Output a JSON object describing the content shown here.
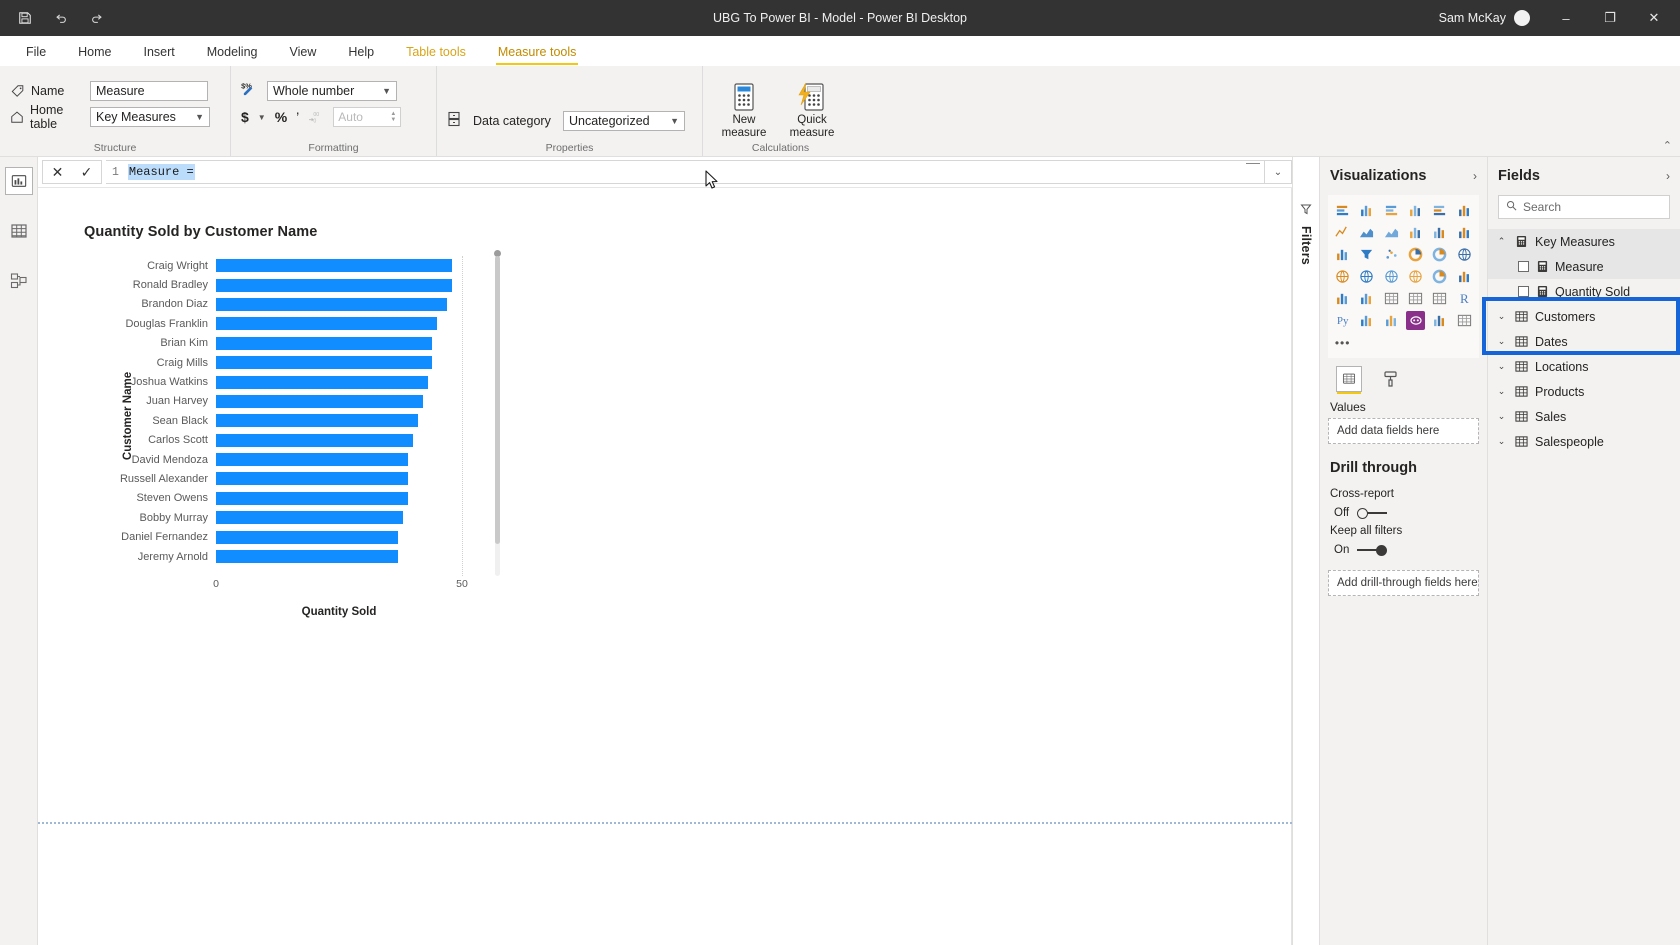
{
  "titlebar": {
    "document_title": "UBG To Power BI - Model - Power BI Desktop",
    "user": "Sam McKay",
    "save_icon": "save-icon",
    "undo_icon": "undo-icon",
    "redo_icon": "redo-icon",
    "minimize": "–",
    "restore": "❐",
    "close": "✕"
  },
  "ribbon_tabs": [
    {
      "label": "File",
      "state": "normal"
    },
    {
      "label": "Home",
      "state": "normal"
    },
    {
      "label": "Insert",
      "state": "normal"
    },
    {
      "label": "Modeling",
      "state": "normal"
    },
    {
      "label": "View",
      "state": "normal"
    },
    {
      "label": "Help",
      "state": "normal"
    },
    {
      "label": "Table tools",
      "state": "contextual"
    },
    {
      "label": "Measure tools",
      "state": "active"
    }
  ],
  "ribbon": {
    "groups": [
      {
        "name": "Structure"
      },
      {
        "name": "Formatting"
      },
      {
        "name": "Properties"
      },
      {
        "name": "Calculations"
      }
    ],
    "structure": {
      "name_label": "Name",
      "name_value": "Measure",
      "home_table_label": "Home table",
      "home_table_value": "Key Measures"
    },
    "formatting": {
      "format_value": "Whole number",
      "currency_symbol": "$",
      "percent_symbol": "%",
      "thousands_symbol": "’",
      "decimal_symbol": "→.0",
      "decimal_places_placeholder": "Auto"
    },
    "properties": {
      "data_category_label": "Data category",
      "data_category_value": "Uncategorized"
    },
    "calculations": {
      "new_measure_line1": "New",
      "new_measure_line2": "measure",
      "quick_measure_line1": "Quick",
      "quick_measure_line2": "measure"
    },
    "collapse_caret": "⌃"
  },
  "formula_bar": {
    "cancel_icon": "✕",
    "commit_icon": "✓",
    "line_number": "1",
    "expression": "Measure =",
    "expand_icon": "⌄"
  },
  "left_rail": [
    {
      "name": "report-view",
      "icon": "report-bar-chart-icon",
      "selected": true
    },
    {
      "name": "data-view",
      "icon": "data-table-icon",
      "selected": false
    },
    {
      "name": "model-view",
      "icon": "model-relationship-icon",
      "selected": false
    }
  ],
  "filters_pane": {
    "label": "Filters",
    "icon": "filter-funnel-icon"
  },
  "visualizations": {
    "title": "Visualizations",
    "expand_icon": "›",
    "icon_names": [
      "stacked-bar-chart-icon",
      "stacked-column-chart-icon",
      "clustered-bar-chart-icon",
      "clustered-column-chart-icon",
      "100-stacked-bar-chart-icon",
      "100-stacked-column-chart-icon",
      "line-chart-icon",
      "area-chart-icon",
      "stacked-area-chart-icon",
      "line-stacked-column-icon",
      "line-clustered-column-icon",
      "ribbon-chart-icon",
      "waterfall-chart-icon",
      "funnel-chart-icon",
      "scatter-chart-icon",
      "pie-chart-icon",
      "donut-chart-icon",
      "treemap-icon",
      "map-icon",
      "filled-map-icon",
      "shape-map-icon",
      "azure-map-icon",
      "gauge-chart-icon",
      "card-icon",
      "multi-row-card-icon",
      "kpi-icon",
      "slicer-icon",
      "table-icon",
      "matrix-icon",
      "r-script-visual-icon",
      "python-visual-icon",
      "key-influencers-icon",
      "decomposition-tree-icon",
      "qna-icon",
      "smart-narrative-icon",
      "paginated-report-icon",
      "more-options-icon"
    ],
    "field_tabs": [
      {
        "name": "fields-tab",
        "icon": "fields-build-icon",
        "selected": true
      },
      {
        "name": "format-tab",
        "icon": "format-paint-roller-icon",
        "selected": false
      }
    ],
    "values_label": "Values",
    "values_placeholder": "Add data fields here",
    "drill_through": {
      "title": "Drill through",
      "cross_report_label": "Cross-report",
      "cross_report_state": "Off",
      "cross_report_on": false,
      "keep_all_filters_label": "Keep all filters",
      "keep_all_filters_state": "On",
      "keep_all_filters_on": true,
      "drill_placeholder": "Add drill-through fields here"
    }
  },
  "fields": {
    "title": "Fields",
    "expand_icon": "›",
    "search_placeholder": "Search",
    "search_icon": "search-icon",
    "items": [
      {
        "label": "Key Measures",
        "type": "table",
        "icon": "measure-table-icon",
        "expanded": true,
        "depth": 0,
        "highlighted": true
      },
      {
        "label": "Measure",
        "type": "measure",
        "icon": "measure-icon",
        "depth": 1,
        "checked": false,
        "highlighted": true
      },
      {
        "label": "Quantity Sold",
        "type": "measure",
        "icon": "measure-icon",
        "depth": 1,
        "checked": false,
        "highlighted": false
      },
      {
        "label": "Customers",
        "type": "table",
        "icon": "table-icon",
        "expanded": false,
        "depth": 0,
        "highlighted": false
      },
      {
        "label": "Dates",
        "type": "table",
        "icon": "table-icon",
        "expanded": false,
        "depth": 0,
        "highlighted": false
      },
      {
        "label": "Locations",
        "type": "table",
        "icon": "table-icon",
        "expanded": false,
        "depth": 0,
        "highlighted": false
      },
      {
        "label": "Products",
        "type": "table",
        "icon": "table-icon",
        "expanded": false,
        "depth": 0,
        "highlighted": false
      },
      {
        "label": "Sales",
        "type": "table",
        "icon": "table-icon",
        "expanded": false,
        "depth": 0,
        "highlighted": false
      },
      {
        "label": "Salespeople",
        "type": "table",
        "icon": "table-icon",
        "expanded": false,
        "depth": 0,
        "highlighted": false
      }
    ],
    "highlight_color": "#1565d8"
  },
  "chart_data": {
    "type": "bar",
    "title": "Quantity Sold by Customer Name",
    "xlabel": "Quantity Sold",
    "ylabel": "Customer Name",
    "orientation": "horizontal",
    "bar_color": "#118dff",
    "xlim": [
      0,
      50
    ],
    "xticks": [
      0,
      50
    ],
    "grid": true,
    "legend": "none",
    "categories": [
      "Craig Wright",
      "Ronald Bradley",
      "Brandon Diaz",
      "Douglas Franklin",
      "Brian Kim",
      "Craig Mills",
      "Joshua Watkins",
      "Juan Harvey",
      "Sean Black",
      "Carlos Scott",
      "David Mendoza",
      "Russell Alexander",
      "Steven Owens",
      "Bobby Murray",
      "Daniel Fernandez",
      "Jeremy Arnold"
    ],
    "values": [
      48,
      48,
      47,
      45,
      44,
      44,
      43,
      42,
      41,
      40,
      39,
      39,
      39,
      38,
      37,
      37
    ]
  }
}
